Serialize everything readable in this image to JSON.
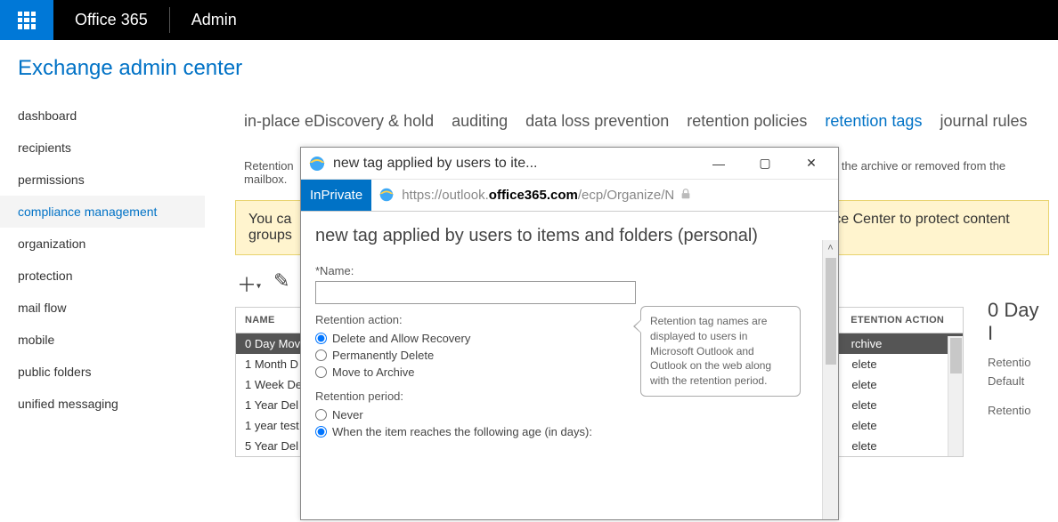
{
  "topbar": {
    "brand": "Office 365",
    "section": "Admin"
  },
  "page_title": "Exchange admin center",
  "leftnav": {
    "items": [
      "dashboard",
      "recipients",
      "permissions",
      "compliance management",
      "organization",
      "protection",
      "mail flow",
      "mobile",
      "public folders",
      "unified messaging"
    ],
    "selected_index": 3
  },
  "tabs": {
    "items": [
      "in-place eDiscovery & hold",
      "auditing",
      "data loss prevention",
      "retention policies",
      "retention tags",
      "journal rules"
    ],
    "active_index": 4
  },
  "description": "Retention",
  "description_tail": "the archive or removed from the mailbox.",
  "banner": {
    "line1_prefix": "You ca",
    "line1_suffix": "ce Center to protect content",
    "line2": "groups"
  },
  "table": {
    "col_name": "NAME",
    "col_action_partial": "ETENTION ACTION",
    "rows": [
      {
        "name": "0 Day Mov",
        "action": "rchive",
        "selected": true
      },
      {
        "name": "1 Month D",
        "action": "elete"
      },
      {
        "name": "1 Week De",
        "action": "elete"
      },
      {
        "name": "1 Year Del",
        "action": "elete"
      },
      {
        "name": "1 year test",
        "action": "elete"
      },
      {
        "name": "5 Year Del",
        "action": "elete"
      }
    ]
  },
  "details": {
    "title": "0 Day I",
    "retention_label": "Retentio",
    "default_label": "Default",
    "retention2": "Retentio"
  },
  "dialog": {
    "window_title": "new tag applied by users to ite...",
    "inprivate": "InPrivate",
    "url_prefix": "https://",
    "url_host1": "outlook.",
    "url_host2": "office365.com",
    "url_path": "/ecp/Organize/N",
    "heading": "new tag applied by users to items and folders (personal)",
    "name_label": "*Name:",
    "retention_action_label": "Retention action:",
    "retention_action_options": [
      "Delete and Allow Recovery",
      "Permanently Delete",
      "Move to Archive"
    ],
    "retention_action_selected": 0,
    "retention_period_label": "Retention period:",
    "retention_period_options": [
      "Never",
      "When the item reaches the following age (in days):"
    ],
    "retention_period_selected": 1,
    "tooltip": "Retention tag names are displayed to users in Microsoft Outlook and Outlook on the web along with the retention period."
  }
}
